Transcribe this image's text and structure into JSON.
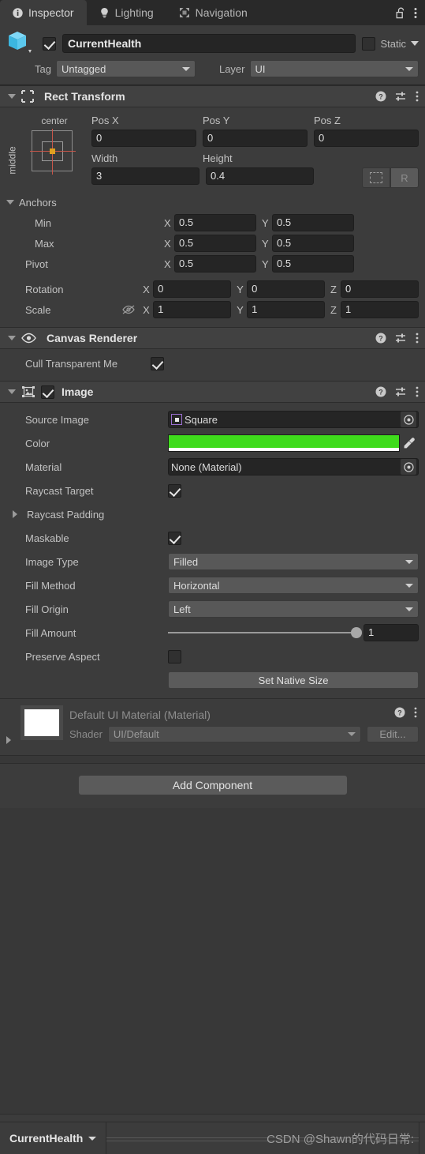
{
  "tabs": [
    {
      "label": "Inspector",
      "icon": "info-icon",
      "active": true
    },
    {
      "label": "Lighting",
      "icon": "lightbulb-icon",
      "active": false
    },
    {
      "label": "Navigation",
      "icon": "navigation-mesh-icon",
      "active": false
    }
  ],
  "tabbar_icons": {
    "lock": "lock-open-icon",
    "menu": "kebab-menu-icon"
  },
  "gameobject": {
    "enabled": true,
    "name": "CurrentHealth",
    "static_label": "Static",
    "static_checked": false,
    "tag_label": "Tag",
    "tag_value": "Untagged",
    "layer_label": "Layer",
    "layer_value": "UI"
  },
  "rect_transform": {
    "title": "Rect Transform",
    "anchor_preset": {
      "horizontal": "center",
      "vertical": "middle"
    },
    "pos_labels": [
      "Pos X",
      "Pos Y",
      "Pos Z"
    ],
    "pos_values": [
      "0",
      "0",
      "0"
    ],
    "size_labels": [
      "Width",
      "Height"
    ],
    "size_values": [
      "3",
      "0.4"
    ],
    "blueprint_button": "blueprint-mode-icon",
    "raw_button": "R",
    "anchors_label": "Anchors",
    "anchor_rows": [
      {
        "label": "Min",
        "x": "0.5",
        "y": "0.5"
      },
      {
        "label": "Max",
        "x": "0.5",
        "y": "0.5"
      },
      {
        "label": "Pivot",
        "x": "0.5",
        "y": "0.5"
      }
    ],
    "rotation_label": "Rotation",
    "rotation": {
      "x": "0",
      "y": "0",
      "z": "0"
    },
    "scale_label": "Scale",
    "scale": {
      "x": "1",
      "y": "1",
      "z": "1"
    },
    "scale_icon": "constrain-proportions-off-icon"
  },
  "canvas_renderer": {
    "title": "Canvas Renderer",
    "icon": "eye-icon",
    "cull_label": "Cull Transparent Me",
    "cull_checked": true
  },
  "image": {
    "title": "Image",
    "icon": "image-component-icon",
    "enabled": true,
    "source_image_label": "Source Image",
    "source_image_value": "Square",
    "color_label": "Color",
    "color_value": "#3FDB1C",
    "material_label": "Material",
    "material_value": "None (Material)",
    "raycast_target_label": "Raycast Target",
    "raycast_target_checked": true,
    "raycast_padding_label": "Raycast Padding",
    "maskable_label": "Maskable",
    "maskable_checked": true,
    "image_type_label": "Image Type",
    "image_type_value": "Filled",
    "fill_method_label": "Fill Method",
    "fill_method_value": "Horizontal",
    "fill_origin_label": "Fill Origin",
    "fill_origin_value": "Left",
    "fill_amount_label": "Fill Amount",
    "fill_amount_value": "1",
    "preserve_aspect_label": "Preserve Aspect",
    "preserve_aspect_checked": false,
    "set_native_size_label": "Set Native Size"
  },
  "material_block": {
    "title": "Default UI Material (Material)",
    "shader_label": "Shader",
    "shader_value": "UI/Default",
    "edit_label": "Edit..."
  },
  "add_component_label": "Add Component",
  "footer": {
    "breadcrumb": "CurrentHealth",
    "watermark": "CSDN @Shawn的代码日常:"
  }
}
